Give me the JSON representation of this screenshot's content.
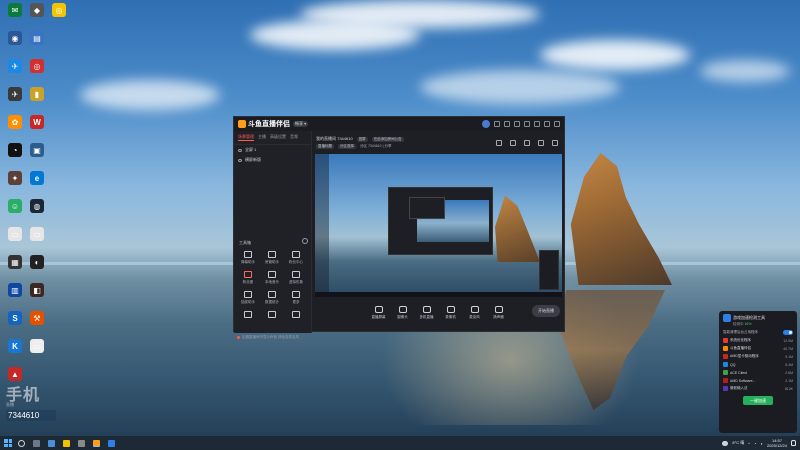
{
  "desktop": {
    "icons": [
      {
        "id": "i1",
        "label": "",
        "color": "#0b7a3b",
        "glyph": "✉"
      },
      {
        "id": "i2",
        "label": "",
        "color": "#555555",
        "glyph": "◆"
      },
      {
        "id": "i3",
        "label": "",
        "color": "#f3c400",
        "glyph": "◎"
      },
      {
        "id": "i4",
        "label": "",
        "color": "#2b5797",
        "glyph": "◉"
      },
      {
        "id": "i5",
        "label": "",
        "color": "#3b73c4",
        "glyph": "▤"
      },
      {
        "id": "i6",
        "label": "",
        "color": "#1e88e5",
        "glyph": "✈"
      },
      {
        "id": "i7",
        "label": "",
        "color": "#d32f2f",
        "glyph": "◎"
      },
      {
        "id": "i8",
        "label": "",
        "color": "#3a3a3a",
        "glyph": "✈"
      },
      {
        "id": "i9",
        "label": "",
        "color": "#c9a227",
        "glyph": "▮"
      },
      {
        "id": "i10",
        "label": "",
        "color": "#ff8f00",
        "glyph": "✿"
      },
      {
        "id": "i11",
        "label": "",
        "color": "#c62828",
        "glyph": "W"
      },
      {
        "id": "i12",
        "label": "",
        "color": "#111111",
        "glyph": "◔"
      },
      {
        "id": "i13",
        "label": "",
        "color": "#2c5d8f",
        "glyph": "▣"
      },
      {
        "id": "i14",
        "label": "",
        "color": "#5d4037",
        "glyph": "✦"
      },
      {
        "id": "i15",
        "label": "",
        "color": "#0078d4",
        "glyph": "e"
      },
      {
        "id": "i16",
        "label": "",
        "color": "#2aae67",
        "glyph": "☺"
      },
      {
        "id": "i17",
        "label": "",
        "color": "#1b2838",
        "glyph": "◍"
      },
      {
        "id": "i18",
        "label": "",
        "color": "#e6e6e6",
        "glyph": "▭"
      },
      {
        "id": "i19",
        "label": "",
        "color": "#e6e6e6",
        "glyph": "▭"
      },
      {
        "id": "i20",
        "label": "",
        "color": "#333333",
        "glyph": "▦"
      },
      {
        "id": "i21",
        "label": "",
        "color": "#222222",
        "glyph": "◐"
      },
      {
        "id": "i22",
        "label": "",
        "color": "#0d47a1",
        "glyph": "▥"
      },
      {
        "id": "i23",
        "label": "",
        "color": "#3e2723",
        "glyph": "◧"
      },
      {
        "id": "i24",
        "label": "",
        "color": "#1565c0",
        "glyph": "S"
      },
      {
        "id": "i25",
        "label": "",
        "color": "#e65100",
        "glyph": "⚒"
      },
      {
        "id": "i26",
        "label": "",
        "color": "#1976d2",
        "glyph": "K"
      },
      {
        "id": "i27",
        "label": "",
        "color": "#eeeeee",
        "glyph": "▭"
      },
      {
        "id": "i28",
        "label": "",
        "color": "#c62828",
        "glyph": "▲"
      }
    ]
  },
  "watermark": {
    "logo": "手机",
    "sub": "直播",
    "id": "7344610"
  },
  "app": {
    "title": "斗鱼直播伴侣",
    "version_badge": "畅享 ▾",
    "tabs": [
      "场景管理",
      "主播",
      "高级设置",
      "音频"
    ],
    "scenes": [
      "全屏 1",
      "横屏新版"
    ],
    "room_title": "我的直播间 7344610",
    "room_chip1": "竖屏",
    "room_chip2": "在此添加房间公告",
    "room_tag1": "直播标题",
    "room_tag2": "分区选择",
    "room_info": "分区 7344610  |  分享",
    "tools_title": "工具箱",
    "tools": [
      {
        "label": "弹幕助手",
        "hot": false
      },
      {
        "label": "房管助手",
        "hot": false
      },
      {
        "label": "粉丝中心",
        "hot": false
      },
      {
        "label": "粉丝团",
        "hot": true
      },
      {
        "label": "本地音乐",
        "hot": false
      },
      {
        "label": "虚拟形象",
        "hot": false
      },
      {
        "label": "抽奖助手",
        "hot": false
      },
      {
        "label": "数据统计",
        "hot": false
      },
      {
        "label": "更多",
        "hot": false
      },
      {
        "label": "",
        "hot": false
      },
      {
        "label": "",
        "hot": false
      },
      {
        "label": "",
        "hot": false
      }
    ],
    "notice": "如遇直播间不显示声音 请检查麦克风",
    "bottom_tools": [
      "直播屏幕",
      "摄像头",
      "多机直播",
      "录像机",
      "麦克风",
      "扬声器"
    ],
    "start_live": "开始直播"
  },
  "perf": {
    "title": "游戏加速检测工具",
    "subtitle_prefix": "检测中",
    "subtitle_value": "16%",
    "toggle_label": "智能清理后台占用程序",
    "rows": [
      {
        "name": "系统优化程序",
        "value": "12.0M",
        "color": "#e53935"
      },
      {
        "name": "斗鱼直播伴侣",
        "value": "40.7M",
        "color": "#fb8c00"
      },
      {
        "name": "AMD显卡驱动程序",
        "value": "9.1M",
        "color": "#c62828"
      },
      {
        "name": "QQ",
        "value": "5.4M",
        "color": "#1e88e5"
      },
      {
        "name": "ACE Client",
        "value": "2.6M",
        "color": "#43a047"
      },
      {
        "name": "AMD Software...",
        "value": "2.1M",
        "color": "#b71c1c"
      },
      {
        "name": "微软输入法",
        "value": "812K",
        "color": "#5e35b1"
      }
    ],
    "button": "一键加速"
  },
  "taskbar": {
    "temp": "8°C 晴",
    "time": "14:57",
    "date": "2025/12/24"
  }
}
